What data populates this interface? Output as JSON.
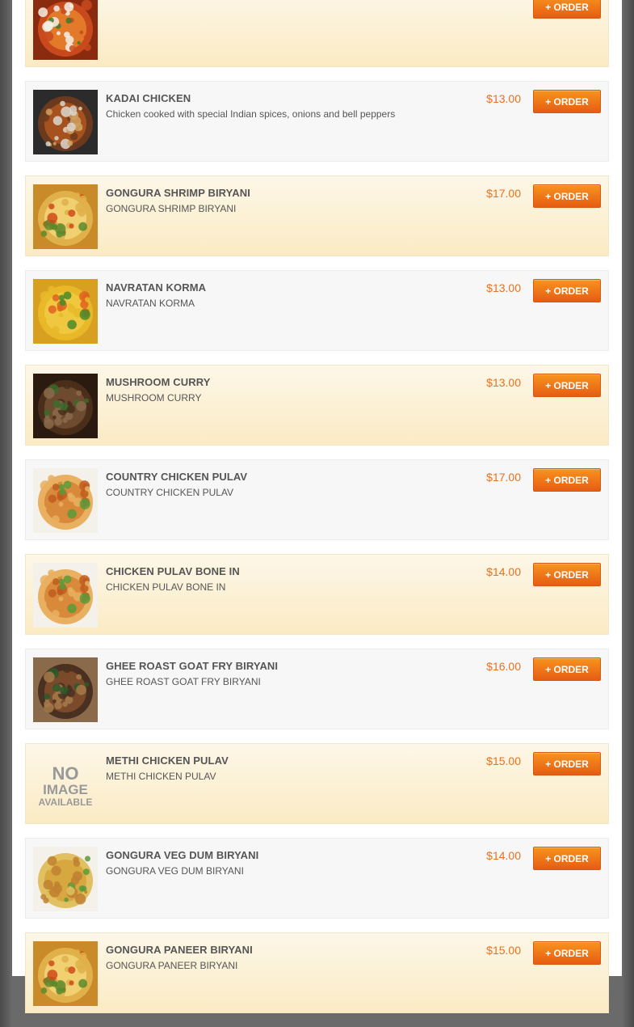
{
  "menu": {
    "order_label": "+ ORDER",
    "items": [
      {
        "name": "",
        "description": "",
        "price": "",
        "image": "curry-dish-image"
      },
      {
        "name": "KADAI CHICKEN",
        "description": "Chicken cooked with special Indian spices, onions and bell peppers",
        "price": "$13.00",
        "image": "kadai-chicken-image"
      },
      {
        "name": "GONGURA SHRIMP BIRYANI",
        "description": "GONGURA SHRIMP BIRYANI",
        "price": "$17.00",
        "image": "biryani-image"
      },
      {
        "name": "NAVRATAN KORMA",
        "description": "NAVRATAN KORMA",
        "price": "$13.00",
        "image": "korma-image"
      },
      {
        "name": "MUSHROOM CURRY",
        "description": "MUSHROOM CURRY",
        "price": "$13.00",
        "image": "mushroom-image"
      },
      {
        "name": "COUNTRY CHICKEN PULAV",
        "description": "COUNTRY CHICKEN PULAV",
        "price": "$17.00",
        "image": "pulav-image"
      },
      {
        "name": "CHICKEN PULAV BONE IN",
        "description": "CHICKEN PULAV BONE IN",
        "price": "$14.00",
        "image": "pulav-image"
      },
      {
        "name": "GHEE ROAST GOAT FRY BIRYANI",
        "description": "GHEE ROAST GOAT FRY BIRYANI",
        "price": "$16.00",
        "image": "goat-fry-image"
      },
      {
        "name": "METHI CHICKEN PULAV",
        "description": "METHI CHICKEN PULAV",
        "price": "$15.00",
        "image": "no-image-placeholder"
      },
      {
        "name": "GONGURA VEG DUM BIRYANI",
        "description": "GONGURA VEG DUM BIRYANI",
        "price": "$14.00",
        "image": "veg-biryani-image"
      },
      {
        "name": "GONGURA PANEER BIRYANI",
        "description": "GONGURA PANEER BIRYANI",
        "price": "$15.00",
        "image": "biryani-image"
      }
    ]
  },
  "no_image": {
    "line1": "NO",
    "line2": "IMAGE",
    "line3": "AVAILABLE"
  },
  "colors": {
    "accent": "#e8711c",
    "button": "#f07a1c",
    "alt_row": "#fbebc4",
    "row": "#f7f7f7"
  }
}
